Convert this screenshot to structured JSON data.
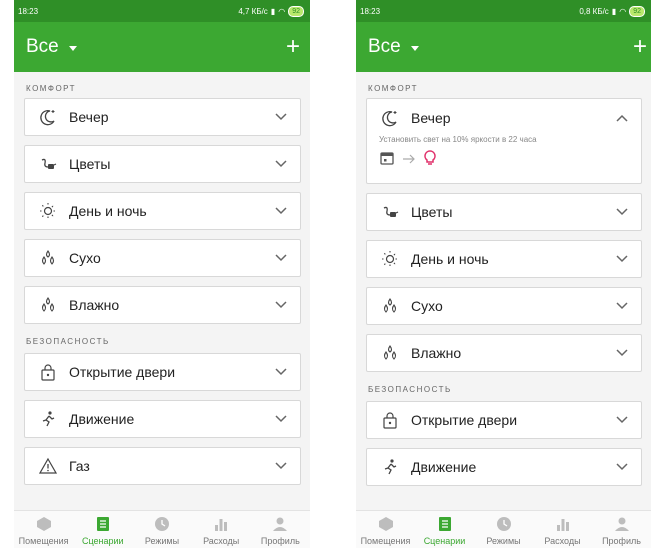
{
  "colors": {
    "primary": "#3ca832",
    "statusbar": "#2f8f27",
    "bulb": "#e0306a"
  },
  "left": {
    "status": {
      "time": "18:23",
      "right": "4,7 КБ/с",
      "battery": "92"
    },
    "appbar": {
      "title": "Все",
      "plus": "+"
    },
    "sections": [
      {
        "title": "КОМФОРТ",
        "items": [
          {
            "label": "Вечер",
            "icon": "moon-icon"
          },
          {
            "label": "Цветы",
            "icon": "watering-icon"
          },
          {
            "label": "День и ночь",
            "icon": "sun-icon"
          },
          {
            "label": "Сухо",
            "icon": "drops-icon"
          },
          {
            "label": "Влажно",
            "icon": "drops-icon"
          }
        ]
      },
      {
        "title": "БЕЗОПАСНОСТЬ",
        "items": [
          {
            "label": "Открытие двери",
            "icon": "door-lock-icon"
          },
          {
            "label": "Движение",
            "icon": "motion-icon"
          },
          {
            "label": "Газ",
            "icon": "warning-icon"
          }
        ]
      }
    ]
  },
  "right": {
    "status": {
      "time": "18:23",
      "right": "0,8 КБ/с",
      "battery": "92"
    },
    "appbar": {
      "title": "Все",
      "plus": "+"
    },
    "sections": [
      {
        "title": "КОМФОРТ",
        "expanded": {
          "label": "Вечер",
          "description": "Установить свет на 10% яркости в 22 часа"
        },
        "items": [
          {
            "label": "Цветы",
            "icon": "watering-icon"
          },
          {
            "label": "День и ночь",
            "icon": "sun-icon"
          },
          {
            "label": "Сухо",
            "icon": "drops-icon"
          },
          {
            "label": "Влажно",
            "icon": "drops-icon"
          }
        ]
      },
      {
        "title": "БЕЗОПАСНОСТЬ",
        "items": [
          {
            "label": "Открытие двери",
            "icon": "door-lock-icon"
          },
          {
            "label": "Движение",
            "icon": "motion-icon"
          }
        ]
      }
    ]
  },
  "nav": [
    "Помещения",
    "Сценарии",
    "Режимы",
    "Расходы",
    "Профиль"
  ],
  "nav_active_index": 1
}
